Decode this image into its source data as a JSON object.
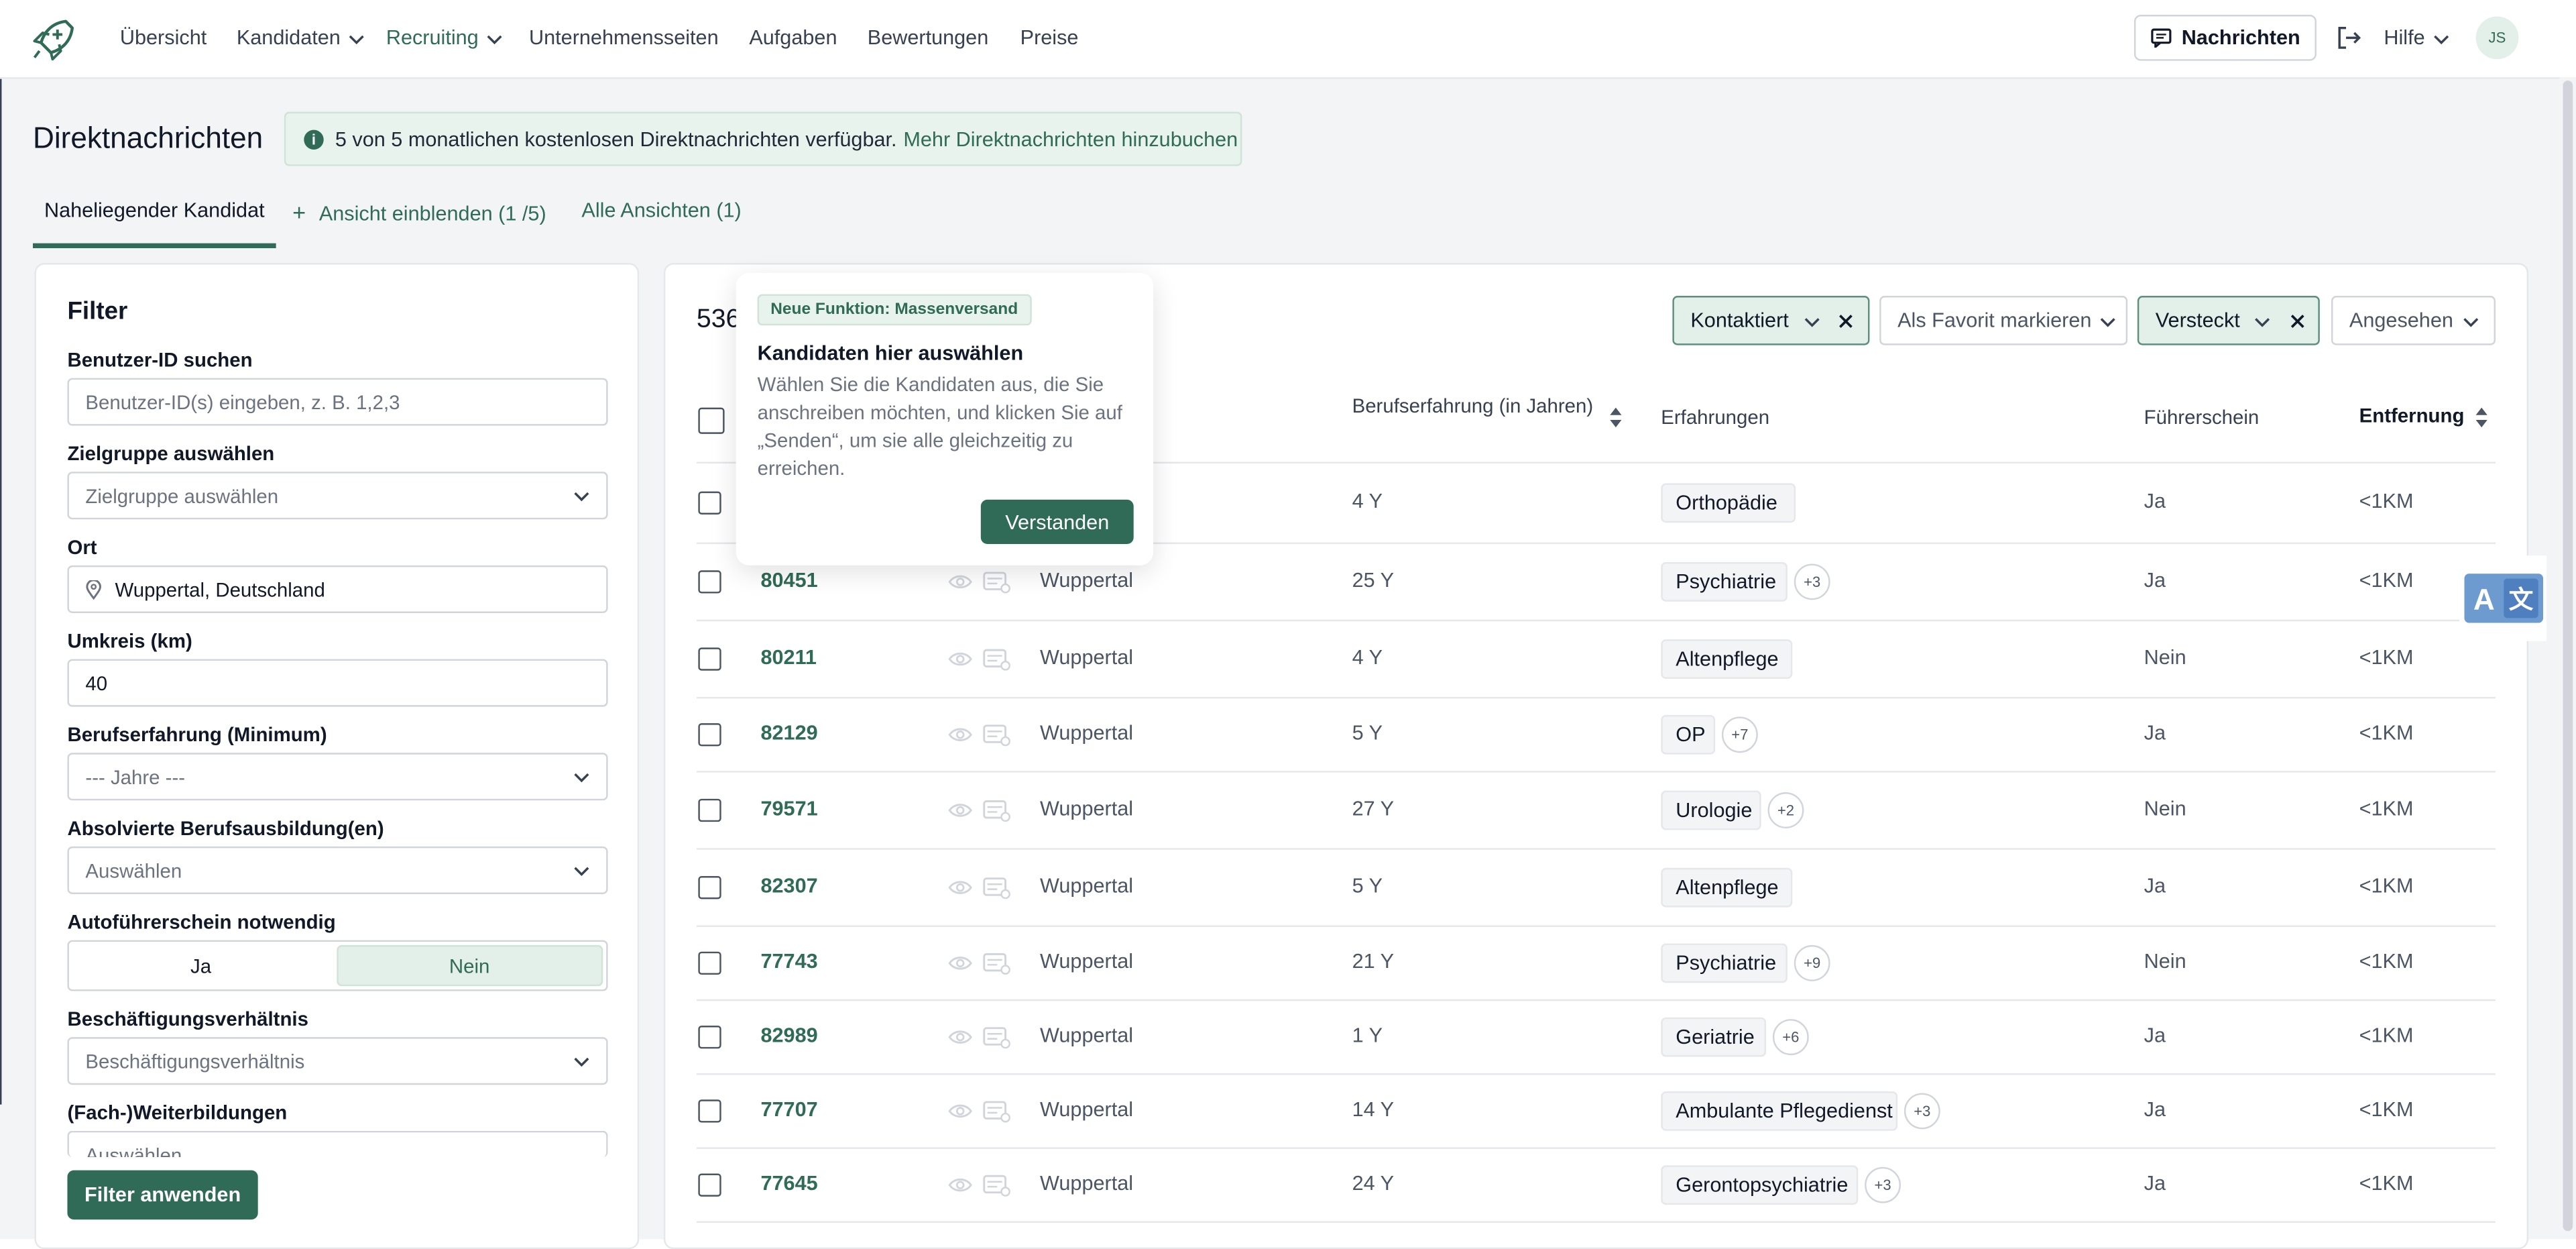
{
  "nav": {
    "items": [
      "Übersicht",
      "Kandidaten",
      "Recruiting",
      "Unternehmensseiten",
      "Aufgaben",
      "Bewertungen",
      "Preise"
    ],
    "messages_label": "Nachrichten",
    "help_label": "Hilfe",
    "avatar_initials": "JS",
    "accent_color": "#2f6b57"
  },
  "page": {
    "title": "Direktnachrichten",
    "info_text": "5 von 5 monatlichen kostenlosen Direktnachrichten verfügbar.",
    "info_link": "Mehr Direktnachrichten hinzubuchen"
  },
  "tabs": {
    "active": "Naheliegender Kandidat",
    "add_view": "Ansicht einblenden (1 /5)",
    "all_views": "Alle Ansichten (1)"
  },
  "filter": {
    "title": "Filter",
    "user_id_label": "Benutzer-ID suchen",
    "user_id_placeholder": "Benutzer-ID(s) eingeben, z. B. 1,2,3",
    "target_label": "Zielgruppe auswählen",
    "target_value": "Zielgruppe auswählen",
    "location_label": "Ort",
    "location_value": "Wuppertal, Deutschland",
    "radius_label": "Umkreis (km)",
    "radius_value": "40",
    "experience_label": "Berufserfahrung (Minimum)",
    "experience_value": "--- Jahre ---",
    "training_label": "Absolvierte Berufsausbildung(en)",
    "training_value": "Auswählen",
    "license_label": "Autoführerschein notwendig",
    "license_yes": "Ja",
    "license_no": "Nein",
    "employment_label": "Beschäftigungsverhältnis",
    "employment_value": "Beschäftigungsverhältnis",
    "further_label": "(Fach-)Weiterbildungen",
    "further_value": "Auswählen",
    "apply_label": "Filter anwenden"
  },
  "results": {
    "count": "536",
    "chips": {
      "contacted": "Kontaktiert",
      "favorite": "Als Favorit markieren",
      "hidden": "Versteckt",
      "viewed": "Angesehen"
    },
    "headers": {
      "experience": "Berufserfahrung (in Jahren)",
      "skills": "Erfahrungen",
      "license": "Führerschein",
      "distance": "Entfernung"
    },
    "rows": [
      {
        "id": "",
        "city": "",
        "years": "4 Y",
        "tag": "Orthopädie",
        "more": "",
        "license": "Ja",
        "distance": "<1KM"
      },
      {
        "id": "80451",
        "city": "Wuppertal",
        "years": "25 Y",
        "tag": "Psychiatrie",
        "more": "+3",
        "license": "Ja",
        "distance": "<1KM"
      },
      {
        "id": "80211",
        "city": "Wuppertal",
        "years": "4 Y",
        "tag": "Altenpflege",
        "more": "",
        "license": "Nein",
        "distance": "<1KM"
      },
      {
        "id": "82129",
        "city": "Wuppertal",
        "years": "5 Y",
        "tag": "OP",
        "more": "+7",
        "license": "Ja",
        "distance": "<1KM"
      },
      {
        "id": "79571",
        "city": "Wuppertal",
        "years": "27 Y",
        "tag": "Urologie",
        "more": "+2",
        "license": "Nein",
        "distance": "<1KM"
      },
      {
        "id": "82307",
        "city": "Wuppertal",
        "years": "5 Y",
        "tag": "Altenpflege",
        "more": "",
        "license": "Ja",
        "distance": "<1KM"
      },
      {
        "id": "77743",
        "city": "Wuppertal",
        "years": "21 Y",
        "tag": "Psychiatrie",
        "more": "+9",
        "license": "Nein",
        "distance": "<1KM"
      },
      {
        "id": "82989",
        "city": "Wuppertal",
        "years": "1 Y",
        "tag": "Geriatrie",
        "more": "+6",
        "license": "Ja",
        "distance": "<1KM"
      },
      {
        "id": "77707",
        "city": "Wuppertal",
        "years": "14 Y",
        "tag": "Ambulante Pflegedienst",
        "more": "+3",
        "license": "Ja",
        "distance": "<1KM"
      },
      {
        "id": "77645",
        "city": "Wuppertal",
        "years": "24 Y",
        "tag": "Gerontopsychiatrie",
        "more": "+3",
        "license": "Ja",
        "distance": "<1KM"
      }
    ]
  },
  "popover": {
    "badge": "Neue Funktion: Massenversand",
    "title": "Kandidaten hier auswählen",
    "body": "Wählen Sie die Kandidaten aus, die Sie anschreiben möchten, und klicken Sie auf „Senden“, um sie alle gleichzeitig zu erreichen.",
    "button": "Verstanden"
  }
}
